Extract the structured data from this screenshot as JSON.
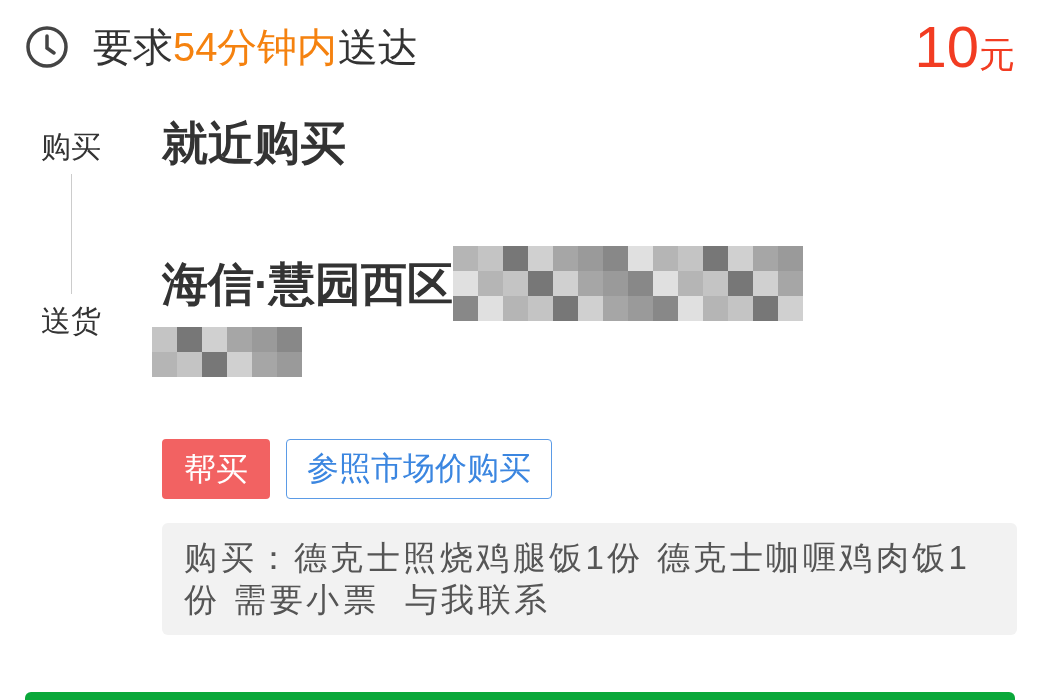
{
  "header": {
    "segments": [
      {
        "text": "要求",
        "highlight": false
      },
      {
        "text": "54分钟内",
        "highlight": true
      },
      {
        "text": "送达",
        "highlight": false
      }
    ],
    "price": "10",
    "currency": "元"
  },
  "route": {
    "from_label": "购买",
    "from_text": "就近购买",
    "to_label": "送货",
    "to_text": "海信·慧园西区",
    "to_redacted": true
  },
  "tags": [
    {
      "kind": "filled",
      "text": "帮买"
    },
    {
      "kind": "outline",
      "text": "参照市场价购买"
    }
  ],
  "note": "购买：德克士照烧鸡腿饭1份 德克士咖喱鸡肉饭1份 需要小票  与我联系"
}
